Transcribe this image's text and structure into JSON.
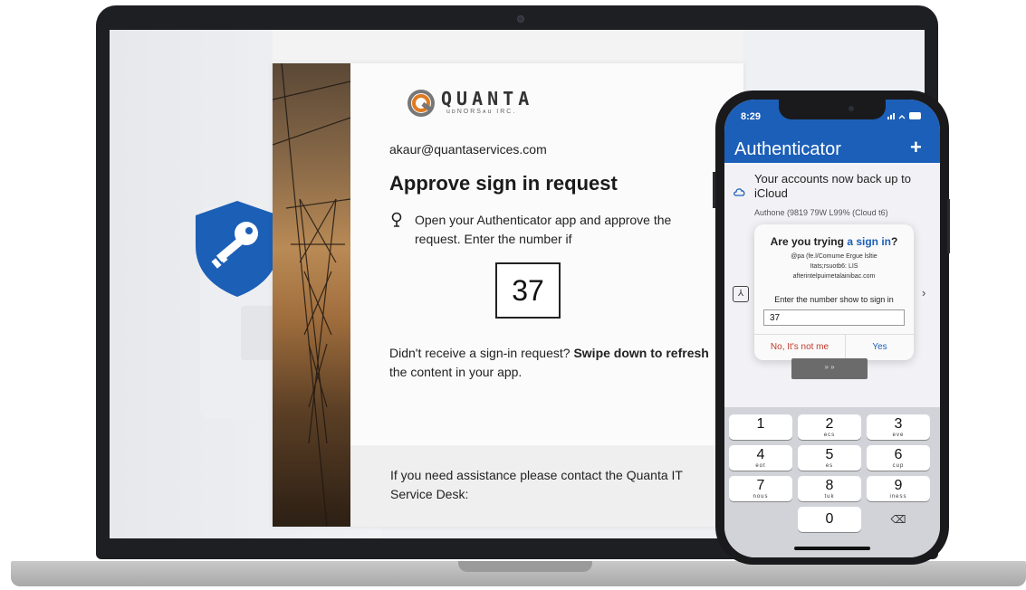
{
  "laptop": {
    "dialog": {
      "logo": {
        "name": "QUANTA",
        "tagline": "uᴅNORSᴀu IRC."
      },
      "email": "akaur@quantaservices.com",
      "heading": "Approve sign in request",
      "instruction": "Open your Authenticator app and approve the request. Enter the number if",
      "number": "37",
      "didnt_prefix": "Didn't receive a sign-in request?",
      "didnt_bold1": "Swipe down to",
      "didnt_bold2": "refresh",
      "didnt_suffix": "the content in your app.",
      "assistance": "If you need assistance please contact the Quanta IT Service Desk:"
    },
    "icons": {
      "shield": "shield-key-icon",
      "instruction": "location-pin-icon"
    },
    "colors": {
      "shield": "#1b5fb6",
      "brand_orange": "#e07a1f"
    }
  },
  "phone": {
    "status": {
      "time": "8:29",
      "icons": "signal wifi battery"
    },
    "app_title": "Authenticator",
    "add_label": "+",
    "backup_text": "Your accounts now back up to iCloud",
    "account_line": "Authone (9819 79W L99% (Cloud t6)",
    "popup": {
      "title_prefix": "Are you trying",
      "title_link": "a sign in",
      "title_suffix": "?",
      "detail_line1": "@pa (fe.l/Comume Ergue lsltie",
      "detail_line2": "Itats;rsuotb6: LIS",
      "detail_line3": "afterintelpuimetalainibac.com",
      "number_label": "Enter the number show to sign in",
      "number_value": "37",
      "no_label": "No, It's not me",
      "yes_label": "Yes"
    },
    "grey_button": "» »",
    "keypad": [
      {
        "digit": "1",
        "letters": ""
      },
      {
        "digit": "2",
        "letters": "ecs"
      },
      {
        "digit": "3",
        "letters": "eve"
      },
      {
        "digit": "4",
        "letters": "eot"
      },
      {
        "digit": "5",
        "letters": "es"
      },
      {
        "digit": "6",
        "letters": "cup"
      },
      {
        "digit": "7",
        "letters": "nous"
      },
      {
        "digit": "8",
        "letters": "tuk"
      },
      {
        "digit": "9",
        "letters": "iness"
      },
      {
        "digit": "0",
        "letters": ""
      }
    ],
    "colors": {
      "header": "#1c5fb8",
      "deny": "#c0392b",
      "accept": "#1c5fb8"
    }
  }
}
